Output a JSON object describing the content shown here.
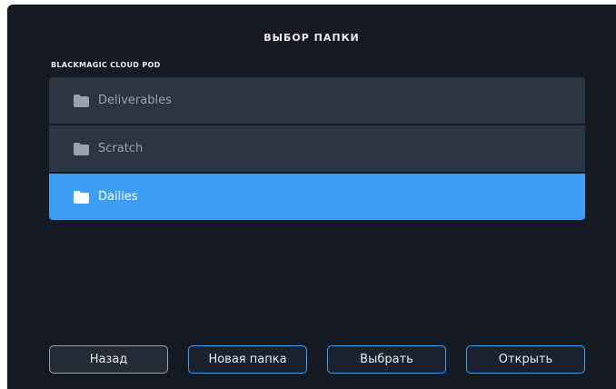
{
  "dialog": {
    "title": "ВЫБОР ПАПКИ",
    "location": "BLACKMAGIC CLOUD POD"
  },
  "folders": [
    {
      "label": "Deliverables",
      "icon": "folder-icon",
      "selected": false
    },
    {
      "label": "Scratch",
      "icon": "folder-icon",
      "selected": false
    },
    {
      "label": "Dailies",
      "icon": "folder-icon",
      "selected": true
    }
  ],
  "buttons": {
    "back": "Назад",
    "new_folder": "Новая папка",
    "select": "Выбрать",
    "open": "Открыть"
  },
  "colors": {
    "background": "#161a22",
    "row": "#2e3542",
    "accent": "#3d9ef5",
    "text": "#e8ebef",
    "muted_text": "#9aa2ad"
  }
}
